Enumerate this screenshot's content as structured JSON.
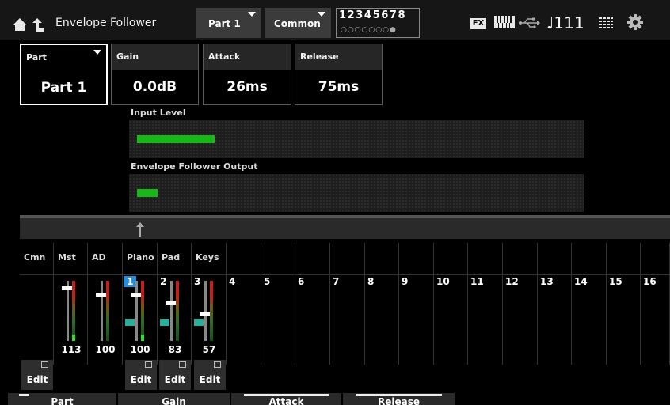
{
  "header": {
    "title": "Envelope Follower",
    "part_button": "Part 1",
    "common_button": "Common",
    "part_numbers": "12345678",
    "part_dots": "○○○○○○○●",
    "fx_label": "FX",
    "tempo": "♩111"
  },
  "params": {
    "part": {
      "label": "Part",
      "value": "Part 1"
    },
    "gain": {
      "label": "Gain",
      "value": "0.0dB"
    },
    "attack": {
      "label": "Attack",
      "value": "26ms"
    },
    "release": {
      "label": "Release",
      "value": "75ms"
    }
  },
  "meters": {
    "input": {
      "label": "Input Level",
      "level": 0.17
    },
    "output": {
      "label": "Envelope Follower Output",
      "level": 0.045
    }
  },
  "mixer": {
    "headers": [
      "Cmn",
      "Mst",
      "AD",
      "Piano",
      "Pad",
      "Keys",
      "",
      "",
      "",
      "",
      "",
      "",
      "",
      "",
      "",
      "",
      "",
      "",
      ""
    ],
    "parts": [
      "1",
      "2",
      "3",
      "4",
      "5",
      "6",
      "7",
      "8",
      "9",
      "10",
      "11",
      "12",
      "13",
      "14",
      "15",
      "16"
    ],
    "faders": [
      {
        "name": "Mst",
        "value": "113",
        "level": 0.88
      },
      {
        "name": "AD",
        "value": "100",
        "level": 0.78
      },
      {
        "name": "Piano",
        "value": "100",
        "level": 0.78
      },
      {
        "name": "Pad",
        "value": "83",
        "level": 0.65
      },
      {
        "name": "Keys",
        "value": "57",
        "level": 0.45
      }
    ],
    "edit_label": "Edit"
  },
  "tabs": [
    {
      "label": "Part"
    },
    {
      "label": "Gain"
    },
    {
      "label": "Attack"
    },
    {
      "label": "Release"
    }
  ],
  "colors": {
    "accent": "#2a8ed6",
    "meter_green": "#18b818",
    "keyboard_icon": "#2cae9a"
  },
  "icons": [
    "home-icon",
    "back-icon",
    "keyboard-icon",
    "usb-icon",
    "grid-icon",
    "gear-icon",
    "up-arrow-icon",
    "edit-icon"
  ]
}
